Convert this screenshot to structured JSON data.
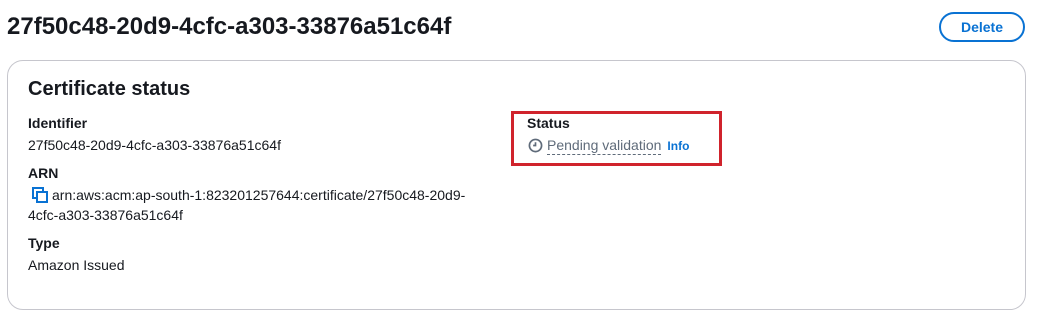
{
  "header": {
    "title": "27f50c48-20d9-4cfc-a303-33876a51c64f",
    "delete_label": "Delete"
  },
  "certificate_status": {
    "heading": "Certificate status",
    "identifier_label": "Identifier",
    "identifier_value": "27f50c48-20d9-4cfc-a303-33876a51c64f",
    "arn_label": "ARN",
    "arn_value_line1": "arn:aws:acm:ap-south-1:823201257644:certificate/27f50c48-20d9-",
    "arn_value_line2": "4cfc-a303-33876a51c64f",
    "type_label": "Type",
    "type_value": "Amazon Issued",
    "status_label": "Status",
    "status_value": "Pending validation",
    "info_label": "Info"
  },
  "icons": {
    "copy": "copy-icon",
    "status": "clock-icon"
  },
  "colors": {
    "link": "#0972d3",
    "highlight": "#d0232c",
    "pending": "#5f6b7a"
  }
}
